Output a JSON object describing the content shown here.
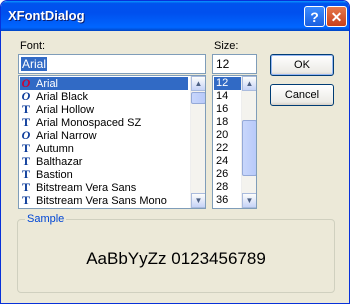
{
  "window": {
    "title": "XFontDialog"
  },
  "titlebar": {
    "help_glyph": "?",
    "close_glyph": "✕"
  },
  "font": {
    "label": "Font:",
    "value": "Arial",
    "items": [
      {
        "name": "Arial",
        "icon": "opentype-icon"
      },
      {
        "name": "Arial Black",
        "icon": "opentype-icon"
      },
      {
        "name": "Arial Hollow",
        "icon": "truetype-icon"
      },
      {
        "name": "Arial Monospaced SZ",
        "icon": "truetype-icon"
      },
      {
        "name": "Arial Narrow",
        "icon": "opentype-icon"
      },
      {
        "name": "Autumn",
        "icon": "truetype-icon"
      },
      {
        "name": "Balthazar",
        "icon": "truetype-icon"
      },
      {
        "name": "Bastion",
        "icon": "truetype-icon"
      },
      {
        "name": "Bitstream Vera Sans",
        "icon": "truetype-icon"
      },
      {
        "name": "Bitstream Vera Sans Mono",
        "icon": "truetype-icon"
      }
    ]
  },
  "size": {
    "label": "Size:",
    "value": "12",
    "items": [
      "12",
      "14",
      "16",
      "18",
      "20",
      "22",
      "24",
      "26",
      "28",
      "36"
    ]
  },
  "buttons": {
    "ok": "OK",
    "cancel": "Cancel"
  },
  "sample": {
    "label": "Sample",
    "text": "AaBbYyZz 0123456789"
  },
  "colors": {
    "selection": "#316ac5",
    "titlebar": "#0053ee",
    "group_label": "#0046d5"
  }
}
